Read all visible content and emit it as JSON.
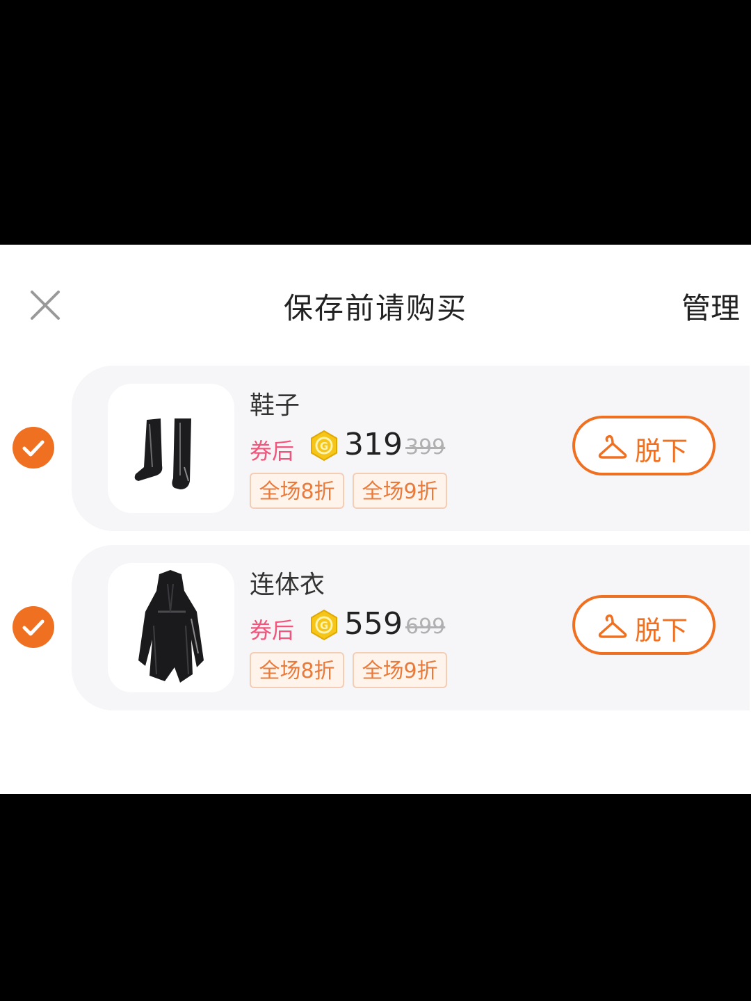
{
  "sheet": {
    "title": "保存前请购买",
    "manage_label": "管理",
    "close_icon": "close-icon"
  },
  "colors": {
    "accent": "#F07022",
    "coupon_label": "#F0557B",
    "card_bg": "#F6F5F7",
    "tag_text": "#E87A3B"
  },
  "items": [
    {
      "name": "鞋子",
      "selected": true,
      "price_label": "券后",
      "currency_icon": "gold-coin-icon",
      "price": "319",
      "original_price": "399",
      "tags": [
        "全场8折",
        "全场9折"
      ],
      "action_label": "脱下",
      "action_icon": "hanger-icon"
    },
    {
      "name": "连体衣",
      "selected": true,
      "price_label": "券后",
      "currency_icon": "gold-coin-icon",
      "price": "559",
      "original_price": "699",
      "tags": [
        "全场8折",
        "全场9折"
      ],
      "action_label": "脱下",
      "action_icon": "hanger-icon"
    }
  ]
}
